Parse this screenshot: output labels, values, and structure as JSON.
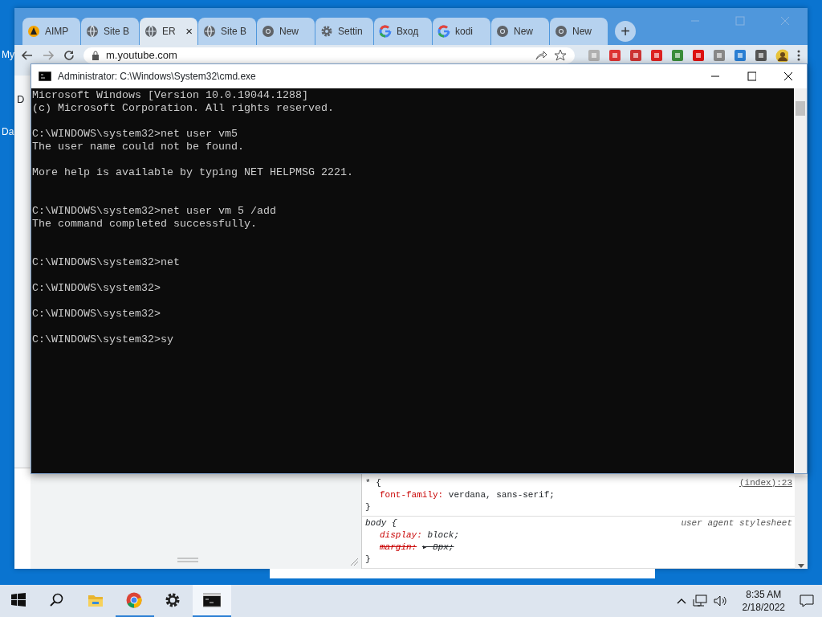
{
  "desktop": {
    "icon_labels": [
      "My",
      "Da"
    ]
  },
  "browser": {
    "tabs": [
      {
        "label": "AIMP",
        "kind": "aimp",
        "selected": false
      },
      {
        "label": "Site B",
        "kind": "globe",
        "selected": false
      },
      {
        "label": "ER",
        "kind": "globe",
        "selected": true,
        "close": "×"
      },
      {
        "label": "Site B",
        "kind": "globe",
        "selected": false
      },
      {
        "label": "New",
        "kind": "chrome",
        "selected": false
      },
      {
        "label": "Settin",
        "kind": "gear",
        "selected": false
      },
      {
        "label": "Вход",
        "kind": "google",
        "selected": false
      },
      {
        "label": "kodi",
        "kind": "google",
        "selected": false
      },
      {
        "label": "New",
        "kind": "chrome",
        "selected": false
      },
      {
        "label": "New",
        "kind": "chrome",
        "selected": false
      }
    ],
    "new_tab": "+",
    "address": "m.youtube.com",
    "page_fragment": "D",
    "devtools": {
      "rules": [
        {
          "selector": "* {",
          "source": "(index):23",
          "kind": "author",
          "decls": [
            {
              "prop": "font-family:",
              "value": "verdana, sans-serif;",
              "struck": false
            }
          ],
          "close": "}"
        },
        {
          "selector": "body {",
          "source": "user agent stylesheet",
          "kind": "agent",
          "decls": [
            {
              "prop": "display:",
              "value": "block;",
              "struck": false
            },
            {
              "prop": "margin:",
              "value": "▸ 8px;",
              "struck": true
            }
          ],
          "close": "}"
        }
      ]
    }
  },
  "console": {
    "title": "Administrator: C:\\Windows\\System32\\cmd.exe",
    "blocks": [
      {
        "kind": "single",
        "lines": [
          "Microsoft Windows [Version 10.0.19044.1288]",
          "(c) Microsoft Corporation. All rights reserved."
        ]
      },
      {
        "kind": "single",
        "lines": [
          "C:\\WINDOWS\\system32>net user vm5",
          "The user name could not be found."
        ]
      },
      {
        "kind": "single",
        "lines": [
          "More help is available by typing NET HELPMSG 2221."
        ]
      },
      {
        "kind": "double",
        "lines": [
          "C:\\WINDOWS\\system32>net user vm 5 /add",
          "The command completed successfully."
        ]
      },
      {
        "kind": "double",
        "lines": [
          "C:\\WINDOWS\\system32>net"
        ]
      },
      {
        "kind": "single",
        "lines": [
          "C:\\WINDOWS\\system32>"
        ]
      },
      {
        "kind": "single",
        "lines": [
          "C:\\WINDOWS\\system32>"
        ]
      },
      {
        "kind": "single",
        "lines": [
          "C:\\WINDOWS\\system32>sy"
        ]
      }
    ]
  },
  "taskbar": {
    "apps": [
      {
        "kind": "start",
        "running": false,
        "active": false
      },
      {
        "kind": "search",
        "running": false,
        "active": false
      },
      {
        "kind": "explorer",
        "running": false,
        "active": false
      },
      {
        "kind": "chrome",
        "running": true,
        "active": false
      },
      {
        "kind": "settings",
        "running": false,
        "active": false
      },
      {
        "kind": "cmd",
        "running": true,
        "active": true
      }
    ],
    "time": "8:35 AM",
    "date": "2/18/2022"
  }
}
